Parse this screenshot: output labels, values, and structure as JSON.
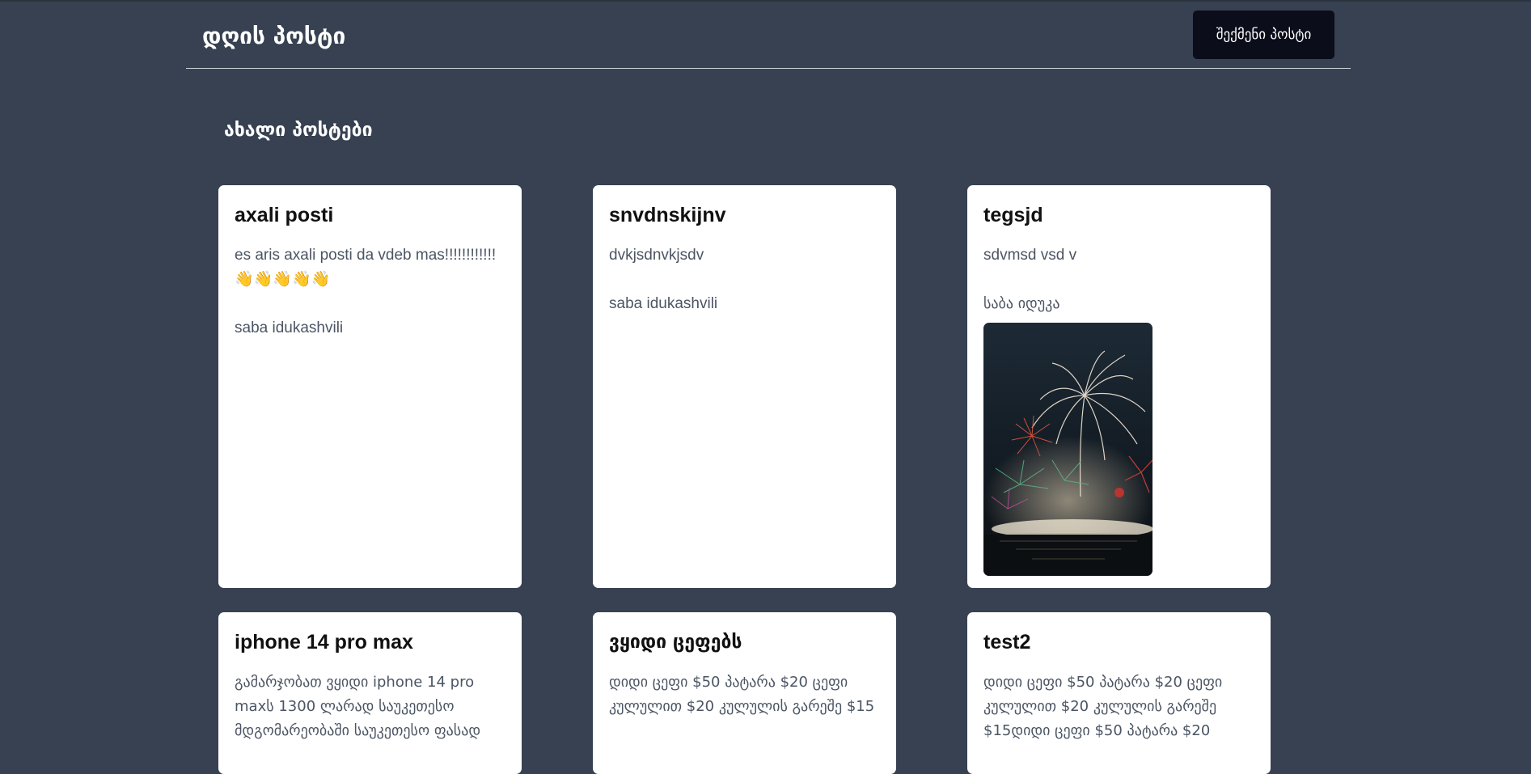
{
  "header": {
    "site_title": "დღის პოსტი",
    "create_button_label": "შექმენი პოსტი"
  },
  "section_title": "ახალი პოსტები",
  "posts": [
    {
      "title": "axali posti",
      "body": "es aris axali posti da vdeb mas!!!!!!!!!!!!👋👋👋👋👋",
      "author": "saba idukashvili"
    },
    {
      "title": "snvdnskijnv",
      "body": "dvkjsdnvkjsdv",
      "author": "saba idukashvili"
    },
    {
      "title": "tegsjd",
      "body": "sdvmsd vsd v",
      "author": "საბა იდუკა",
      "image": "fireworks-photo"
    },
    {
      "title": "iphone 14 pro max",
      "body": "გამარჯობათ ვყიდი iphone 14 pro maxს 1300 ლარად საუკეთესო მდგომარეობაში საუკეთესო ფასად"
    },
    {
      "title": "ვყიდი ცეფებს",
      "body": "დიდი ცეფი $50 პატარა $20 ცეფი კულულით $20 კულულის გარეშე $15"
    },
    {
      "title": "test2",
      "body": "დიდი ცეფი $50 პატარა $20 ცეფი კულულით $20 კულულის გარეშე $15დიდი ცეფი $50 პატარა $20"
    }
  ],
  "colors": {
    "page_background": "#374151",
    "button_background": "#0b0d1a",
    "card_background": "#ffffff",
    "body_text": "#4b5563"
  }
}
